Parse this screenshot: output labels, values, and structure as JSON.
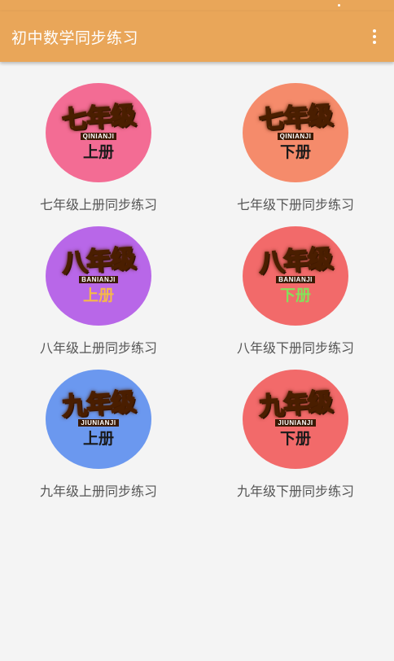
{
  "app_bar": {
    "title": "初中数学同步练习",
    "overflow_icon": "more-vertical-icon",
    "color": "#e9a659"
  },
  "items": [
    {
      "grade": "七年级",
      "pinyin": "QINIANJI",
      "term": "上册",
      "label": "七年级上册同步练习",
      "circle_color": "#f36c94",
      "grade_color": "#f2c51a",
      "term_color": "#1a1a1a"
    },
    {
      "grade": "七年级",
      "pinyin": "QINIANJI",
      "term": "下册",
      "label": "七年级下册同步练习",
      "circle_color": "#f58b6b",
      "grade_color": "#b9e82a",
      "term_color": "#1a1a1a"
    },
    {
      "grade": "八年级",
      "pinyin": "BANIANJI",
      "term": "上册",
      "label": "八年级上册同步练习",
      "circle_color": "#b867e8",
      "grade_color": "#f5c430",
      "term_color": "#f5b84a"
    },
    {
      "grade": "八年级",
      "pinyin": "BANIANJI",
      "term": "下册",
      "label": "八年级下册同步练习",
      "circle_color": "#f26a6a",
      "grade_color": "#72e04a",
      "term_color": "#86e05a"
    },
    {
      "grade": "九年级",
      "pinyin": "JIUNIANJI",
      "term": "上册",
      "label": "九年级上册同步练习",
      "circle_color": "#6b98ef",
      "grade_color": "#f4c02a",
      "term_color": "#1a1a1a"
    },
    {
      "grade": "九年级",
      "pinyin": "JIUNIANJI",
      "term": "下册",
      "label": "九年级下册同步练习",
      "circle_color": "#f26a6a",
      "grade_color": "#35d6c2",
      "term_color": "#1a1a1a"
    }
  ]
}
